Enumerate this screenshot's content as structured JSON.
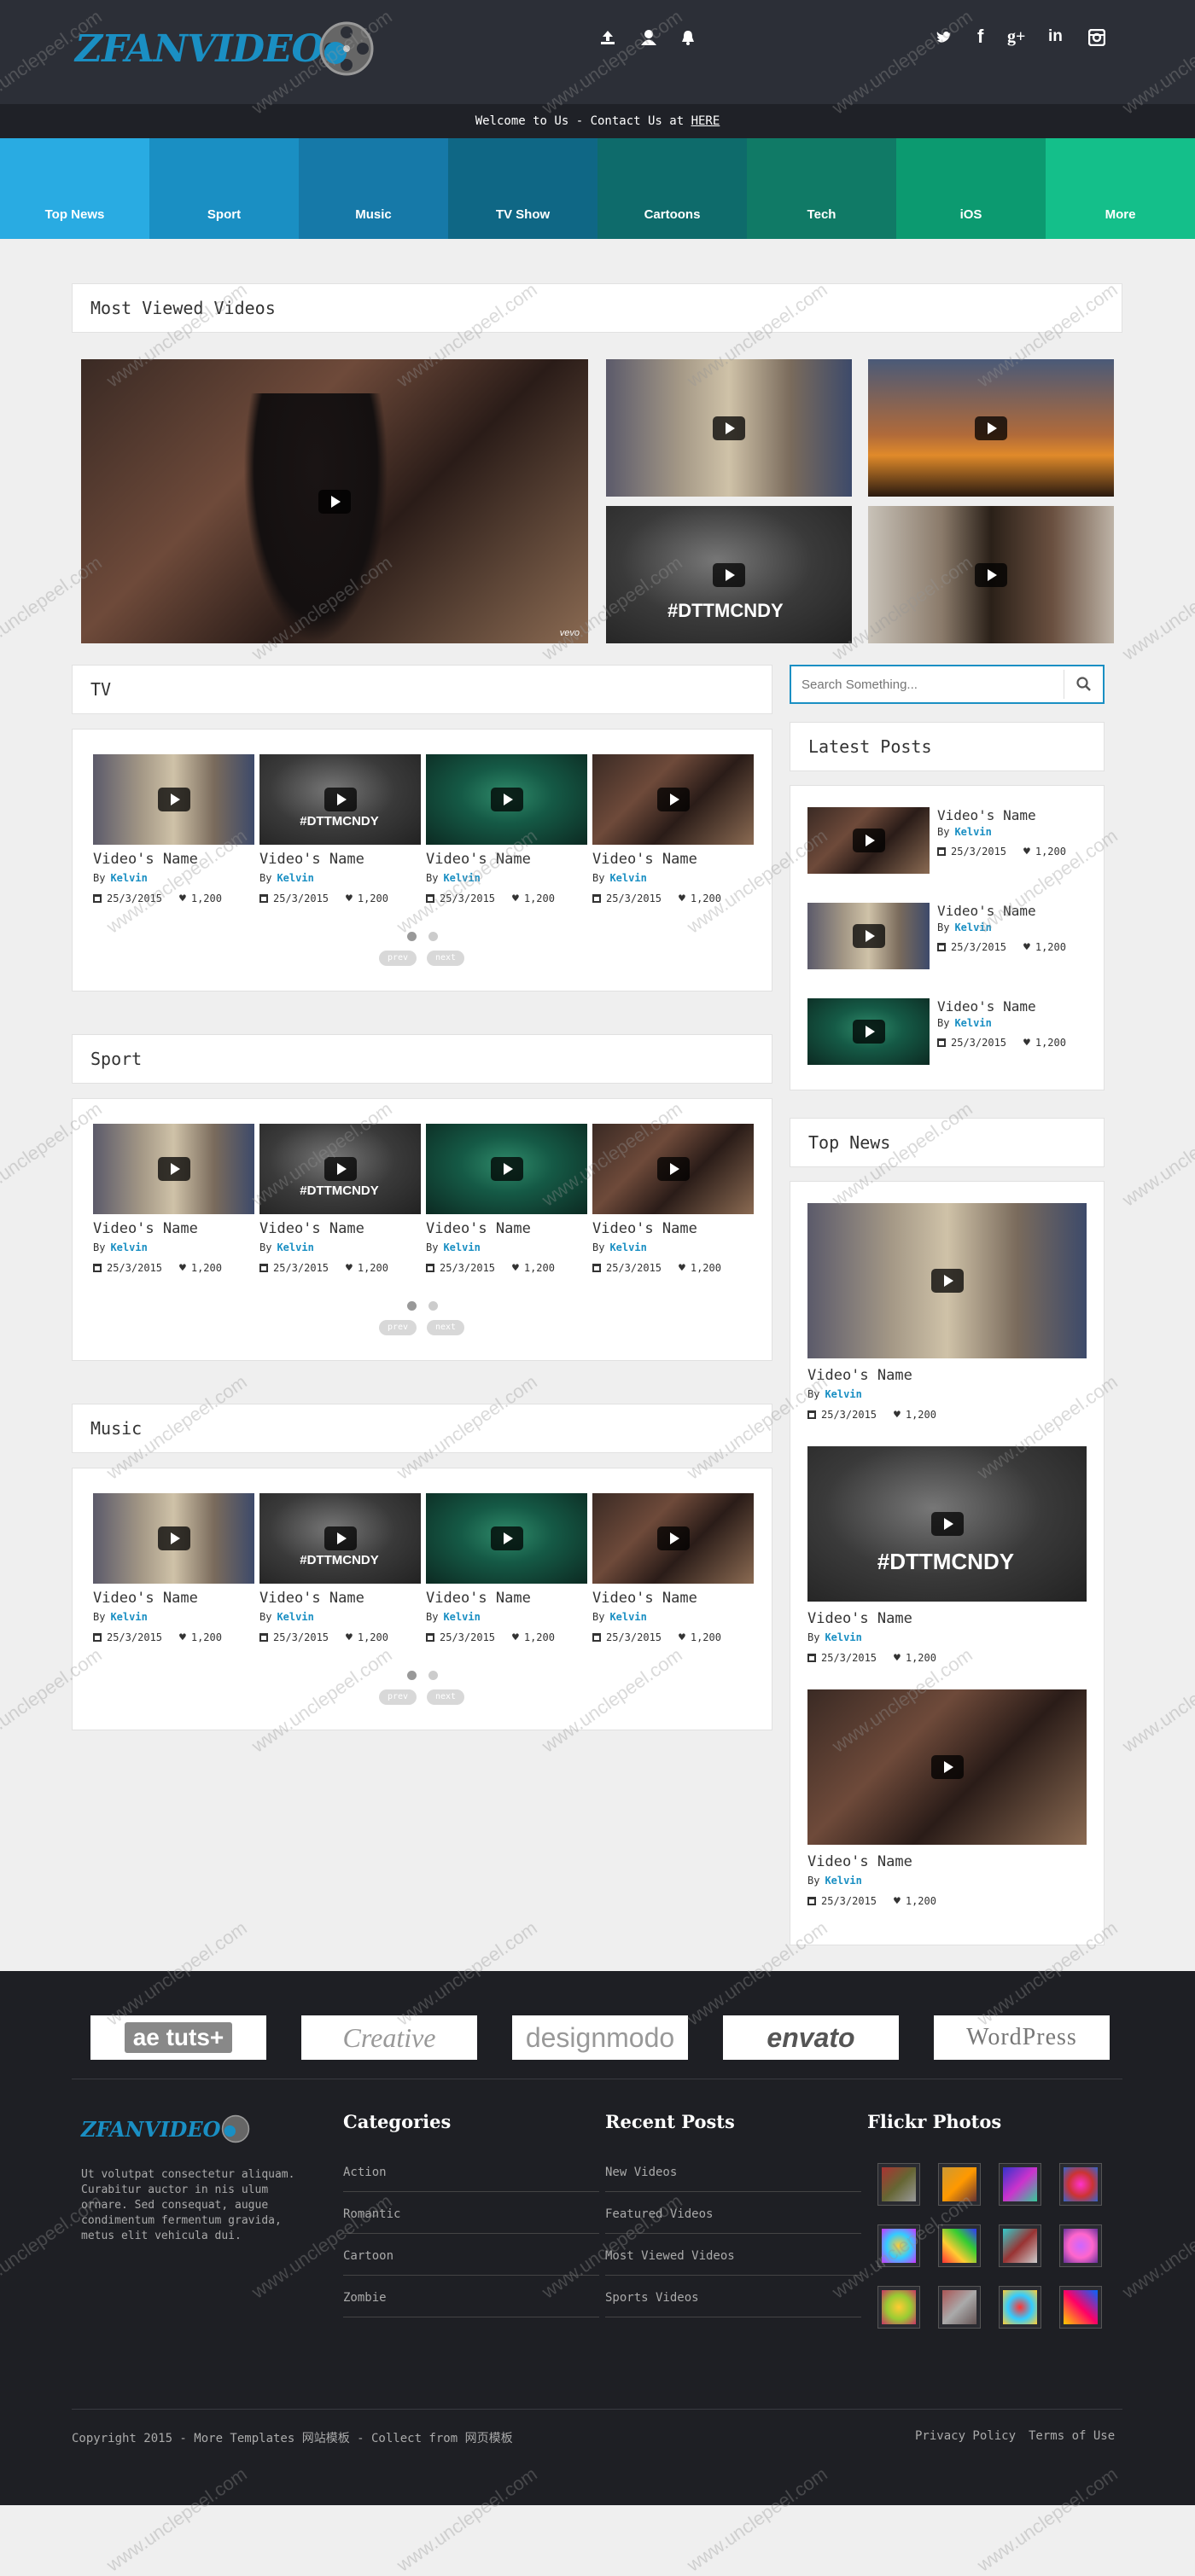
{
  "header": {
    "logo_text": "ZFANVIDEO",
    "welcome_prefix": "Welcome to Us - Contact Us at ",
    "welcome_link": "HERE",
    "user_icons": [
      "upload-icon",
      "user-icon",
      "bell-icon"
    ],
    "social_icons": [
      "twitter-icon",
      "facebook-icon",
      "google-plus-icon",
      "linkedin-icon",
      "instagram-icon"
    ]
  },
  "nav": {
    "items": [
      {
        "label": "Top News",
        "color": "#29abe2"
      },
      {
        "label": "Sport",
        "color": "#1a8fc3"
      },
      {
        "label": "Music",
        "color": "#1679a8"
      },
      {
        "label": "TV Show",
        "color": "#0f6785"
      },
      {
        "label": "Cartoons",
        "color": "#0e6b6b"
      },
      {
        "label": "Tech",
        "color": "#107a66"
      },
      {
        "label": "iOS",
        "color": "#0c9a70"
      },
      {
        "label": "More",
        "color": "#14bf8a"
      }
    ]
  },
  "most_viewed": {
    "title": "Most Viewed Videos"
  },
  "sections": [
    {
      "title": "TV",
      "videos": [
        {
          "name": "Video's Name",
          "by": "By",
          "author": "Kelvin",
          "date": "25/3/2015",
          "likes": "1,200"
        },
        {
          "name": "Video's Name",
          "by": "By",
          "author": "Kelvin",
          "date": "25/3/2015",
          "likes": "1,200"
        },
        {
          "name": "Video's Name",
          "by": "By",
          "author": "Kelvin",
          "date": "25/3/2015",
          "likes": "1,200"
        },
        {
          "name": "Video's Name",
          "by": "By",
          "author": "Kelvin",
          "date": "25/3/2015",
          "likes": "1,200"
        }
      ]
    },
    {
      "title": "Sport",
      "videos": [
        {
          "name": "Video's Name",
          "by": "By",
          "author": "Kelvin",
          "date": "25/3/2015",
          "likes": "1,200"
        },
        {
          "name": "Video's Name",
          "by": "By",
          "author": "Kelvin",
          "date": "25/3/2015",
          "likes": "1,200"
        },
        {
          "name": "Video's Name",
          "by": "By",
          "author": "Kelvin",
          "date": "25/3/2015",
          "likes": "1,200"
        },
        {
          "name": "Video's Name",
          "by": "By",
          "author": "Kelvin",
          "date": "25/3/2015",
          "likes": "1,200"
        }
      ]
    },
    {
      "title": "Music",
      "videos": [
        {
          "name": "Video's Name",
          "by": "By",
          "author": "Kelvin",
          "date": "25/3/2015",
          "likes": "1,200"
        },
        {
          "name": "Video's Name",
          "by": "By",
          "author": "Kelvin",
          "date": "25/3/2015",
          "likes": "1,200"
        },
        {
          "name": "Video's Name",
          "by": "By",
          "author": "Kelvin",
          "date": "25/3/2015",
          "likes": "1,200"
        },
        {
          "name": "Video's Name",
          "by": "By",
          "author": "Kelvin",
          "date": "25/3/2015",
          "likes": "1,200"
        }
      ]
    }
  ],
  "pager": {
    "prev": "prev",
    "next": "next"
  },
  "search": {
    "placeholder": "Search Something..."
  },
  "latest_posts": {
    "title": "Latest Posts",
    "items": [
      {
        "name": "Video's Name",
        "by": "By",
        "author": "Kelvin",
        "date": "25/3/2015",
        "likes": "1,200"
      },
      {
        "name": "Video's Name",
        "by": "By",
        "author": "Kelvin",
        "date": "25/3/2015",
        "likes": "1,200"
      },
      {
        "name": "Video's Name",
        "by": "By",
        "author": "Kelvin",
        "date": "25/3/2015",
        "likes": "1,200"
      }
    ]
  },
  "top_news": {
    "title": "Top News",
    "items": [
      {
        "name": "Video's Name",
        "by": "By",
        "author": "Kelvin",
        "date": "25/3/2015",
        "likes": "1,200"
      },
      {
        "name": "Video's Name",
        "by": "By",
        "author": "Kelvin",
        "date": "25/3/2015",
        "likes": "1,200"
      },
      {
        "name": "Video's Name",
        "by": "By",
        "author": "Kelvin",
        "date": "25/3/2015",
        "likes": "1,200"
      }
    ]
  },
  "video_thumb_caption": "#DTTMCNDY",
  "partners": [
    "ae tuts+",
    "Creative",
    "designmodo",
    "envato",
    "WordPress"
  ],
  "footer": {
    "logo_text": "ZFANVIDEO",
    "about": "Ut volutpat consectetur aliquam. Curabitur auctor in nis ulum ornare. Sed consequat, augue condimentum fermentum gravida, metus elit vehicula dui.",
    "categories_title": "Categories",
    "categories": [
      "Action",
      "Romantic",
      "Cartoon",
      "Zombie"
    ],
    "recent_title": "Recent Posts",
    "recent": [
      "New Videos",
      "Featured Videos",
      "Most Viewed Videos",
      "Sports Videos"
    ],
    "flickr_title": "Flickr Photos",
    "copyright": "Copyright 2015 - More Templates 网站模板 - Collect from 网页模板",
    "privacy": "Privacy Policy",
    "terms": "Terms of Use"
  },
  "watermark": "www.unclepeel.com"
}
